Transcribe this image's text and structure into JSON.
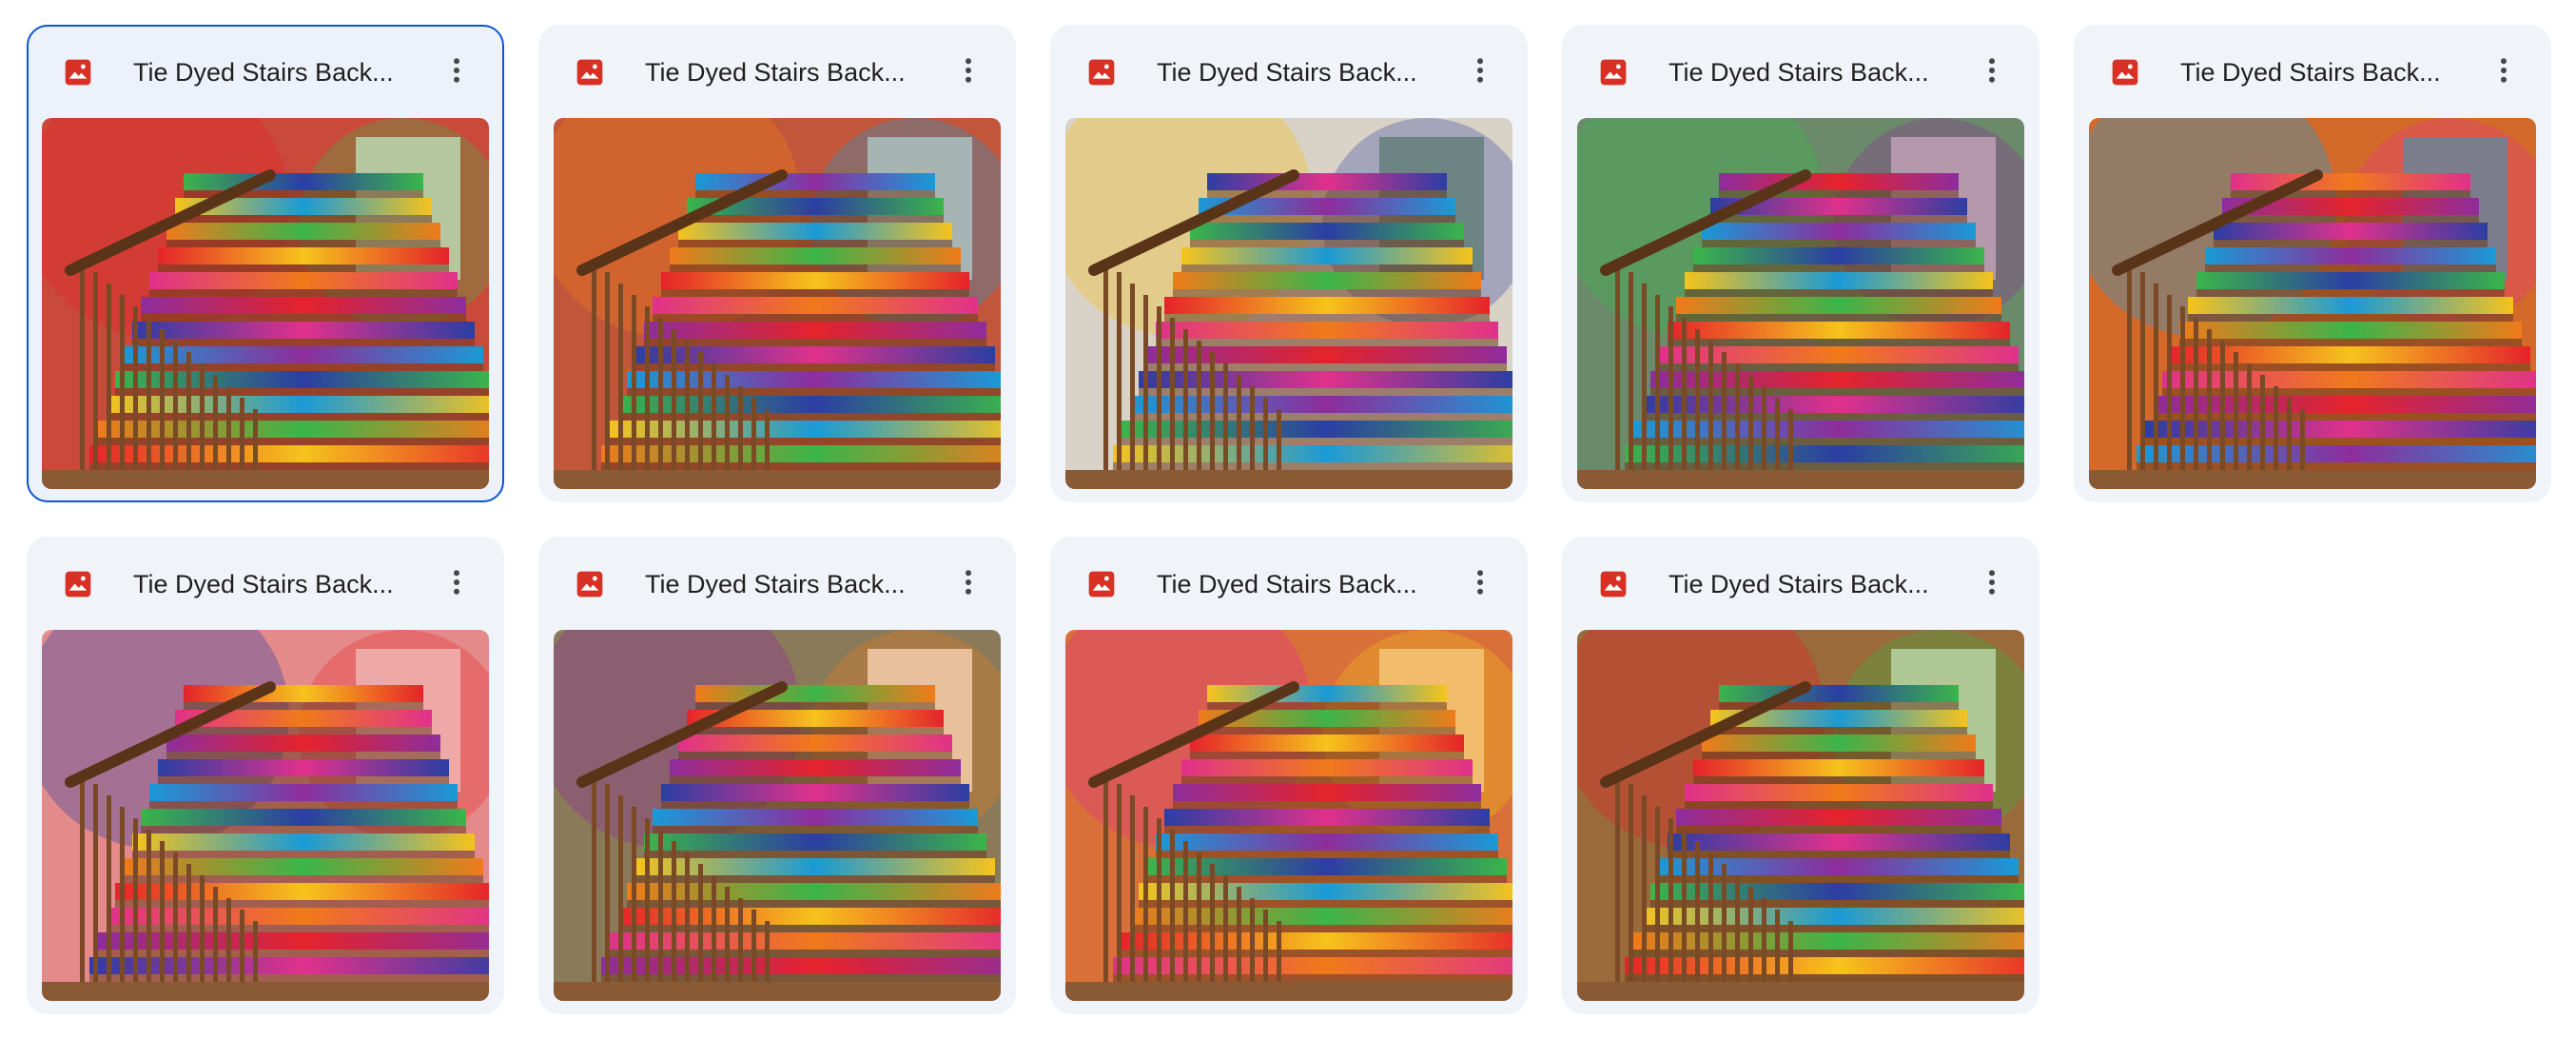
{
  "files": [
    {
      "name": "Tie Dyed Stairs Back...",
      "selected": true,
      "wall": "#c94a3a",
      "accent": "#f0e6dc"
    },
    {
      "name": "Tie Dyed Stairs Back...",
      "selected": false,
      "wall": "#c1563a",
      "accent": "#e8d4b8"
    },
    {
      "name": "Tie Dyed Stairs Back...",
      "selected": false,
      "wall": "#d9d2c6",
      "accent": "#7a9c6a"
    },
    {
      "name": "Tie Dyed Stairs Back...",
      "selected": false,
      "wall": "#6a8a6a",
      "accent": "#d8d0c0"
    },
    {
      "name": "Tie Dyed Stairs Back...",
      "selected": false,
      "wall": "#d46a2a",
      "accent": "#3aa8a0"
    },
    {
      "name": "Tie Dyed Stairs Back...",
      "selected": false,
      "wall": "#e58a8a",
      "accent": "#f4f0ea"
    },
    {
      "name": "Tie Dyed Stairs Back...",
      "selected": false,
      "wall": "#8a7a5a",
      "accent": "#f4f0ea"
    },
    {
      "name": "Tie Dyed Stairs Back...",
      "selected": false,
      "wall": "#d9703a",
      "accent": "#f2c8a0"
    },
    {
      "name": "Tie Dyed Stairs Back...",
      "selected": false,
      "wall": "#9a6a3a",
      "accent": "#eae0cc"
    }
  ],
  "icons": {
    "file_type": "image-file-icon",
    "menu": "more-vert-icon"
  },
  "colors": {
    "image_icon": "#d93025",
    "selection_border": "#0b57d0",
    "card_bg": "#f0f4f9",
    "rainbow": [
      "#e5232b",
      "#f07a1a",
      "#f6c31c",
      "#3bb54a",
      "#1a9ad6",
      "#2c3ea3",
      "#8e2d9c",
      "#e0318b"
    ]
  }
}
